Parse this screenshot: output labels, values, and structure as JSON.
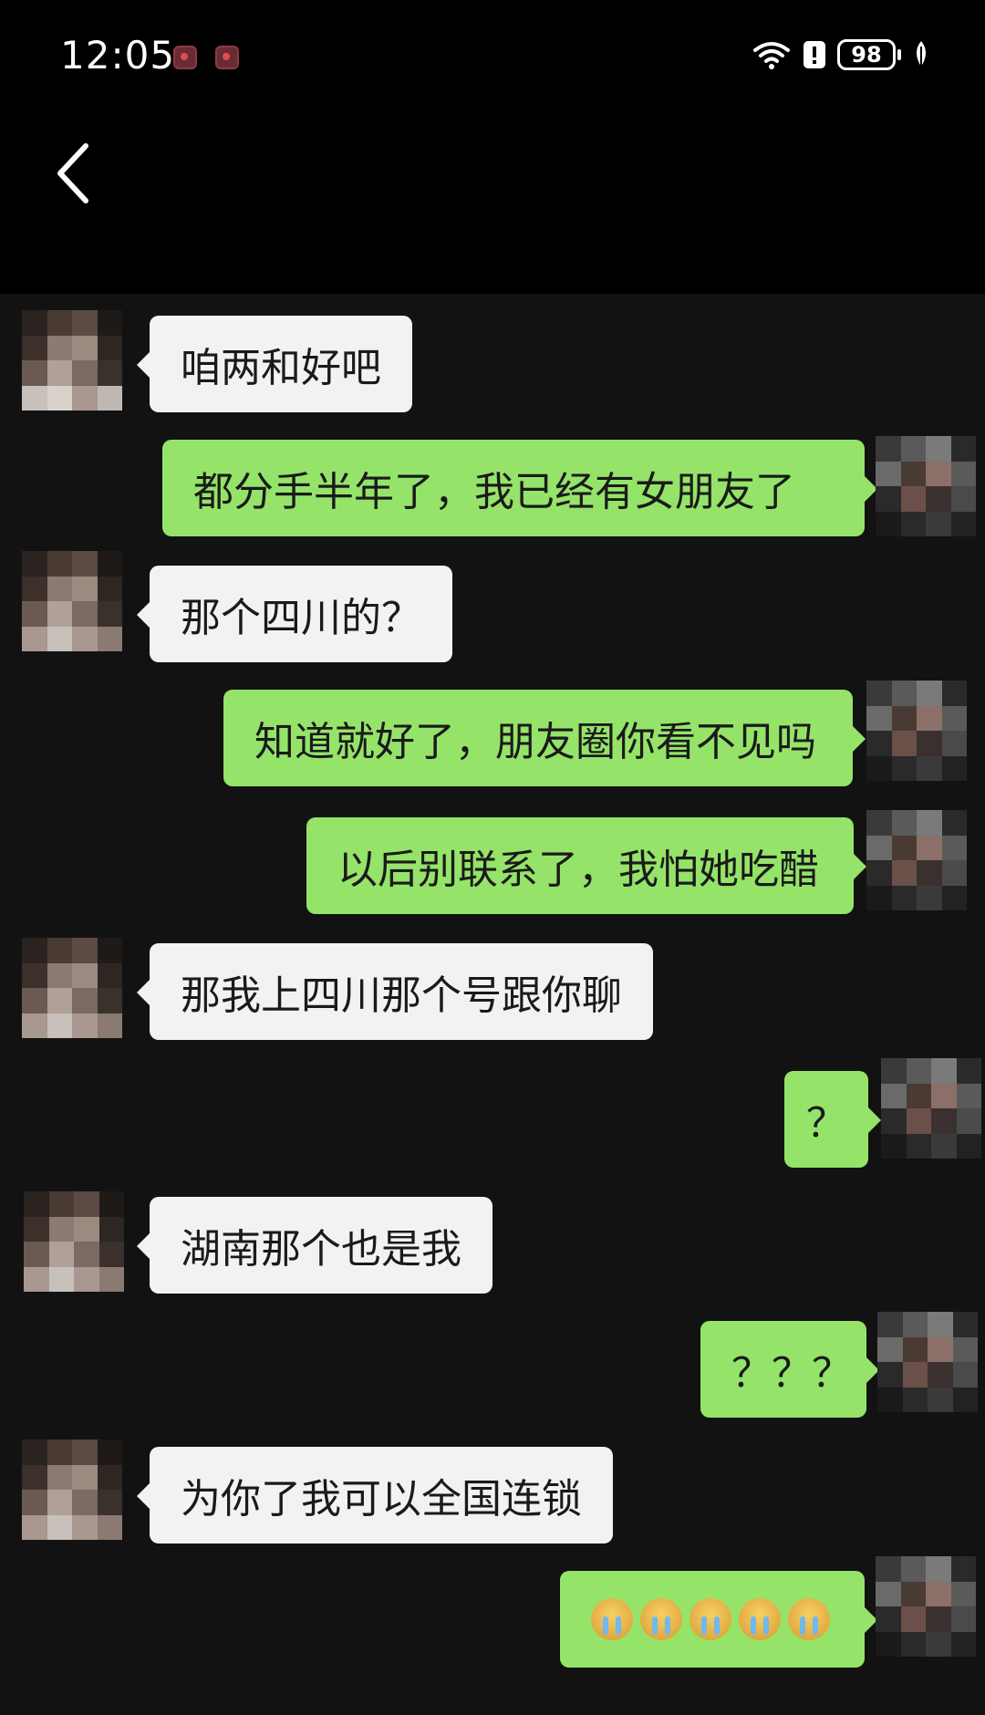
{
  "status_bar": {
    "time": "12:05",
    "battery": "98"
  },
  "messages": [
    {
      "side": "in",
      "text": "咱两和好吧"
    },
    {
      "side": "out",
      "text": "都分手半年了，我已经有女朋友了"
    },
    {
      "side": "in",
      "text": "那个四川的？"
    },
    {
      "side": "out",
      "text": "知道就好了，朋友圈你看不见吗"
    },
    {
      "side": "out",
      "text": "以后别联系了，我怕她吃醋"
    },
    {
      "side": "in",
      "text": "那我上四川那个号跟你聊"
    },
    {
      "side": "out",
      "text": "？"
    },
    {
      "side": "in",
      "text": "湖南那个也是我"
    },
    {
      "side": "out",
      "text": "？？？"
    },
    {
      "side": "in",
      "text": "为你了我可以全国连锁"
    },
    {
      "side": "out",
      "text": "",
      "emoji": "crying-face",
      "emoji_count": 5
    }
  ],
  "colors": {
    "incoming_bubble": "#f2f2f2",
    "outgoing_bubble": "#95e469",
    "chat_background": "#121212"
  }
}
